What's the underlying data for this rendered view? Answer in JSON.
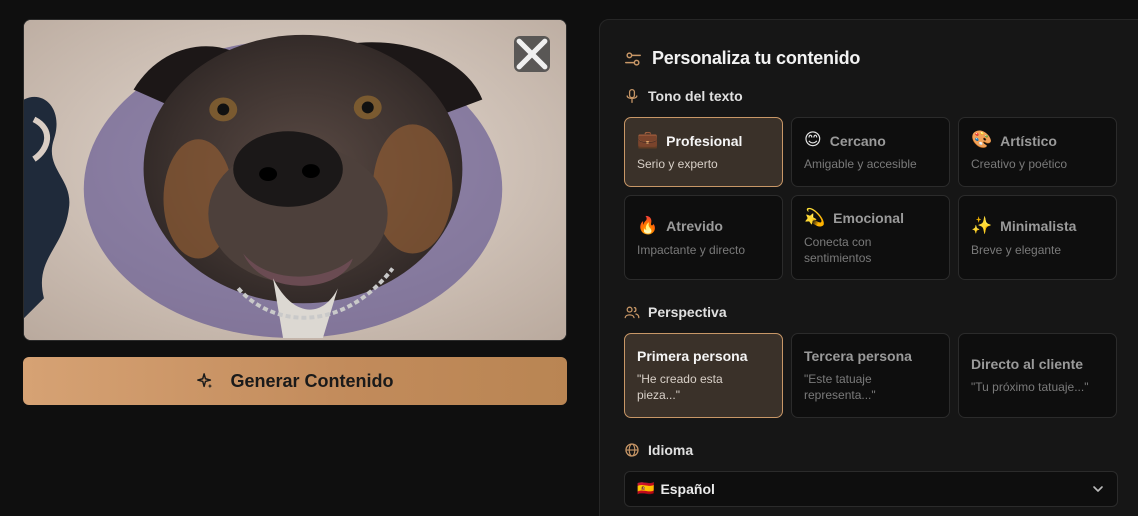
{
  "preview": {
    "close_label": "×"
  },
  "generate_button": {
    "label": "Generar Contenido",
    "icon": "sparkles-icon"
  },
  "panel": {
    "title": "Personaliza tu contenido",
    "title_icon": "sliders-icon",
    "accent_color": "#c89767"
  },
  "tone": {
    "label": "Tono del texto",
    "icon": "microphone-icon",
    "options": [
      {
        "emoji": "💼",
        "title": "Profesional",
        "subtitle": "Serio y experto",
        "selected": true
      },
      {
        "emoji": "😊",
        "title": "Cercano",
        "subtitle": "Amigable y accesible",
        "selected": false
      },
      {
        "emoji": "🎨",
        "title": "Artístico",
        "subtitle": "Creativo y poético",
        "selected": false
      },
      {
        "emoji": "🔥",
        "title": "Atrevido",
        "subtitle": "Impactante y directo",
        "selected": false
      },
      {
        "emoji": "💫",
        "title": "Emocional",
        "subtitle": "Conecta con sentimientos",
        "selected": false
      },
      {
        "emoji": "✨",
        "title": "Minimalista",
        "subtitle": "Breve y elegante",
        "selected": false
      }
    ]
  },
  "perspective": {
    "label": "Perspectiva",
    "icon": "users-icon",
    "options": [
      {
        "title": "Primera persona",
        "subtitle": "\"He creado esta pieza...\"",
        "selected": true
      },
      {
        "title": "Tercera persona",
        "subtitle": "\"Este tatuaje representa...\"",
        "selected": false
      },
      {
        "title": "Directo al cliente",
        "subtitle": "\"Tu próximo tatuaje...\"",
        "selected": false
      }
    ]
  },
  "language": {
    "label": "Idioma",
    "icon": "globe-icon",
    "flag": "🇪🇸",
    "value": "Español"
  }
}
